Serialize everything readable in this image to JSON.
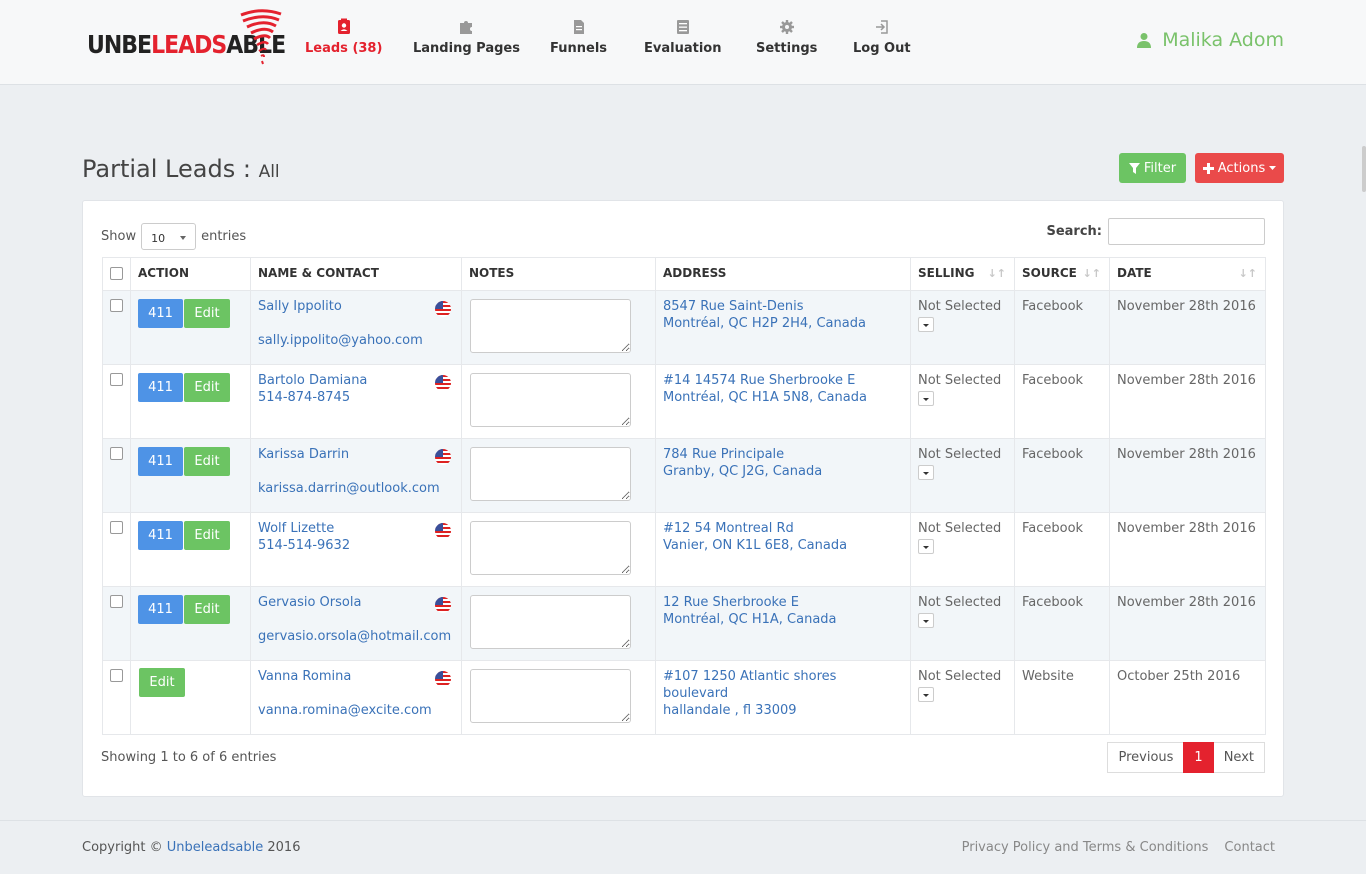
{
  "brand": {
    "part1": "UNBE",
    "part2": "LEADS",
    "part3": "ABLE"
  },
  "nav": [
    {
      "label": "Leads (38)",
      "icon": "contact-card-icon"
    },
    {
      "label": "Landing Pages",
      "icon": "puzzle-icon"
    },
    {
      "label": "Funnels",
      "icon": "file-icon"
    },
    {
      "label": "Evaluation",
      "icon": "list-icon"
    },
    {
      "label": "Settings",
      "icon": "gear-icon"
    },
    {
      "label": "Log Out",
      "icon": "logout-icon"
    }
  ],
  "user": {
    "name": "Malika Adom",
    "icon": "user-icon"
  },
  "page": {
    "title": "Partial Leads :",
    "subtitle": "All"
  },
  "buttons": {
    "filter": "Filter",
    "actions": "Actions"
  },
  "table_controls": {
    "show": "Show",
    "entries_value": "10",
    "entries": "entries",
    "search_label": "Search:"
  },
  "columns": [
    "ACTION",
    "NAME & CONTACT",
    "NOTES",
    "ADDRESS",
    "SELLING",
    "SOURCE",
    "DATE"
  ],
  "rows": [
    {
      "has411": true,
      "btn411": "411",
      "edit": "Edit",
      "name": "Sally Ippolito",
      "phone": "",
      "email": "sally.ippolito@yahoo.com",
      "addr1": "8547 Rue Saint-Denis",
      "addr2": "Montréal, QC H2P 2H4, Canada",
      "selling": "Not Selected",
      "source": "Facebook",
      "date": "November 28th 2016"
    },
    {
      "has411": true,
      "btn411": "411",
      "edit": "Edit",
      "name": "Bartolo Damiana",
      "phone": "514-874-8745",
      "email": "",
      "addr1": "#14 14574 Rue Sherbrooke E",
      "addr2": "Montréal, QC H1A 5N8, Canada",
      "selling": "Not Selected",
      "source": "Facebook",
      "date": "November 28th 2016"
    },
    {
      "has411": true,
      "btn411": "411",
      "edit": "Edit",
      "name": "Karissa Darrin",
      "phone": "",
      "email": "karissa.darrin@outlook.com",
      "addr1": "784 Rue Principale",
      "addr2": "Granby, QC J2G, Canada",
      "selling": "Not Selected",
      "source": "Facebook",
      "date": "November 28th 2016"
    },
    {
      "has411": true,
      "btn411": "411",
      "edit": "Edit",
      "name": "Wolf Lizette",
      "phone": "514-514-9632",
      "email": "",
      "addr1": "#12 54 Montreal Rd",
      "addr2": "Vanier, ON K1L 6E8, Canada",
      "selling": "Not Selected",
      "source": "Facebook",
      "date": "November 28th 2016"
    },
    {
      "has411": true,
      "btn411": "411",
      "edit": "Edit",
      "name": "Gervasio Orsola",
      "phone": "",
      "email": "gervasio.orsola@hotmail.com",
      "addr1": "12 Rue Sherbrooke E",
      "addr2": "Montréal, QC H1A, Canada",
      "selling": "Not Selected",
      "source": "Facebook",
      "date": "November 28th 2016"
    },
    {
      "has411": false,
      "btn411": "",
      "edit": "Edit",
      "name": "Vanna Romina",
      "phone": "",
      "email": "vanna.romina@excite.com",
      "addr1": "#107 1250 Atlantic shores boulevard",
      "addr2": "hallandale , fl 33009",
      "selling": "Not Selected",
      "source": "Website",
      "date": "October 25th 2016"
    }
  ],
  "pagination": {
    "info": "Showing 1 to 6 of 6 entries",
    "previous": "Previous",
    "current": "1",
    "next": "Next"
  },
  "footer": {
    "copyright": "Copyright ©",
    "company": "Unbeleadsable",
    "year": "2016",
    "privacy": "Privacy Policy and Terms & Conditions",
    "contact": "Contact"
  },
  "colors": {
    "brand_red": "#e4222e",
    "green": "#6cc463",
    "blue": "#4e93e6",
    "link": "#3a72b8"
  }
}
